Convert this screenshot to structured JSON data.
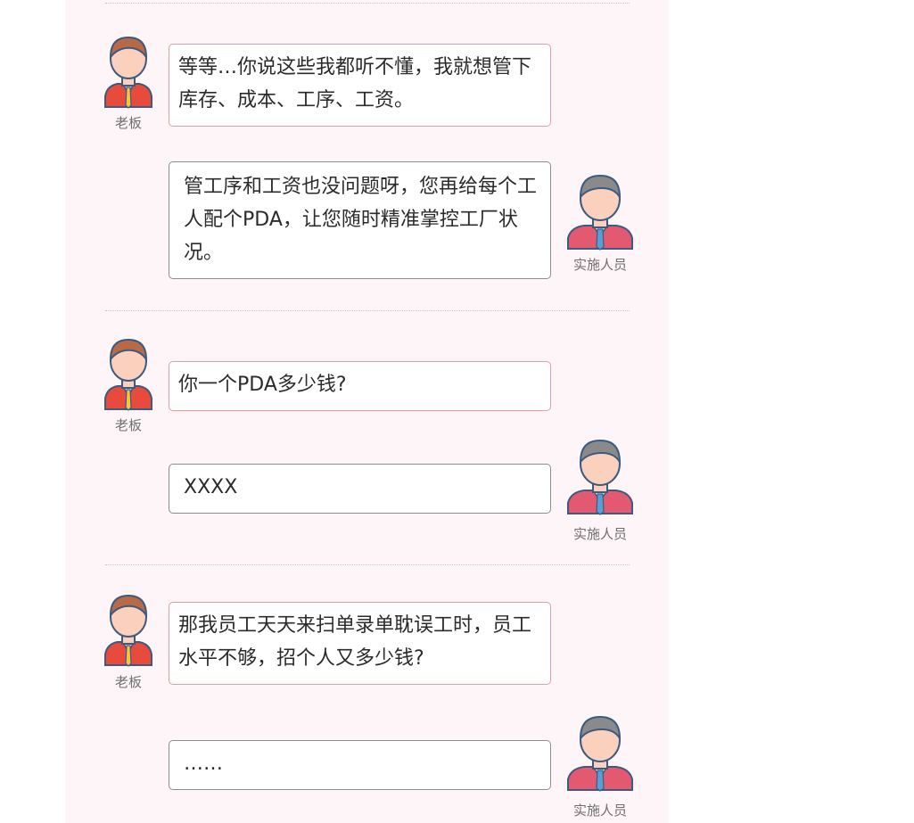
{
  "boss_name": "老板",
  "staff_name": "实施人员",
  "messages": [
    {
      "speaker": "boss",
      "text": "等等…你说这些我都听不懂，我就想管下库存、成本、工序、工资。"
    },
    {
      "speaker": "staff",
      "text": "管工序和工资也没问题呀，您再给每个工人配个PDA，让您随时精准掌控工厂状况。"
    },
    {
      "speaker": "boss",
      "text": "你一个PDA多少钱?"
    },
    {
      "speaker": "staff",
      "text": "XXXX"
    },
    {
      "speaker": "boss",
      "text": "那我员工天天来扫单录单耽误工时，员工水平不够，招个人又多少钱?"
    },
    {
      "speaker": "staff",
      "text": "……"
    }
  ],
  "colors": {
    "panel_bg": "#fdf5f7",
    "boss_border": "#ec9aa6",
    "staff_border": "#8d8d8d",
    "boss_suit": "#e84a3c",
    "staff_suit": "#e35a70"
  },
  "icons": {
    "boss": "boss-avatar-icon",
    "staff": "staff-avatar-icon"
  }
}
